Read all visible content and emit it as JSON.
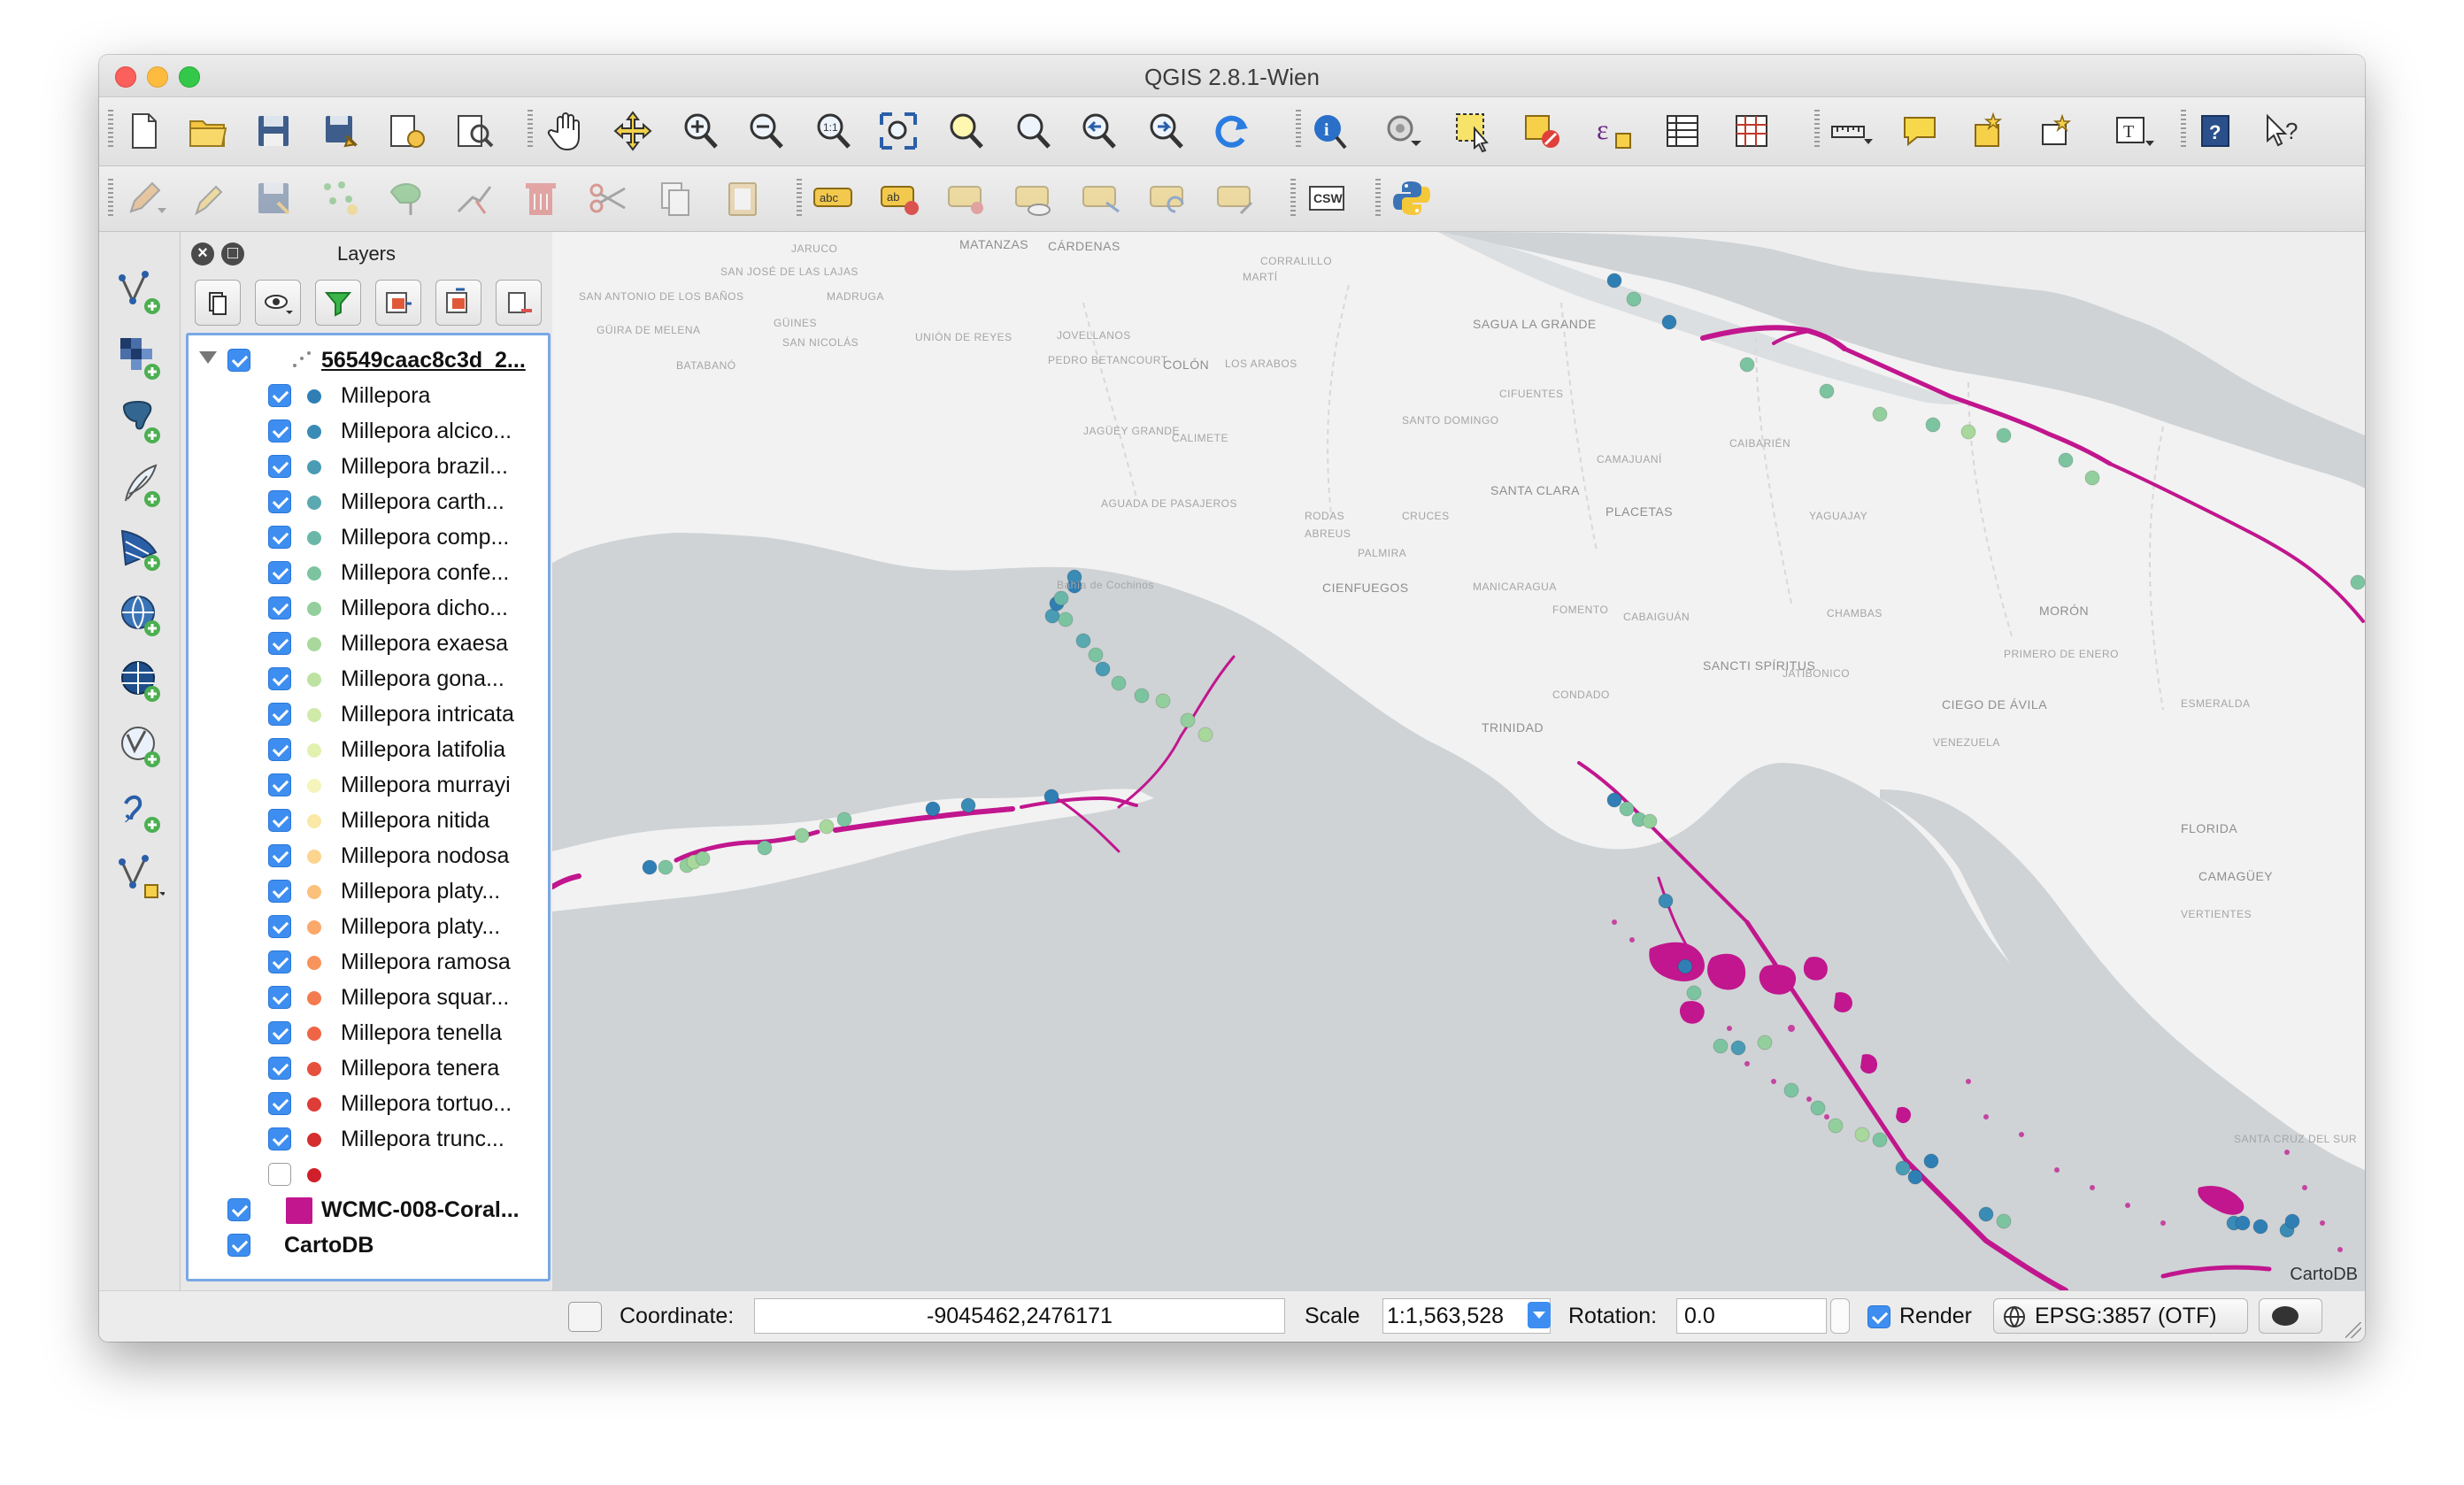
{
  "window": {
    "title": "QGIS 2.8.1-Wien"
  },
  "toolbar_main": {
    "icons": [
      "new-project-icon",
      "open-project-icon",
      "save-project-icon",
      "save-as-icon",
      "new-print-composer-icon",
      "composer-manager-icon",
      "pan-icon",
      "pan-to-selection-icon",
      "zoom-in-icon",
      "zoom-out-icon",
      "zoom-actual-icon",
      "zoom-full-icon",
      "zoom-to-selection-icon",
      "zoom-to-layer-icon",
      "zoom-last-icon",
      "zoom-next-icon",
      "refresh-icon",
      "identify-icon",
      "run-feature-action-icon",
      "select-features-icon",
      "deselect-icon",
      "field-calculator-icon",
      "attribute-table-icon",
      "statistics-icon",
      "measure-icon",
      "map-tips-icon",
      "bookmark-icon",
      "spatial-bookmarks-icon",
      "text-annotation-icon",
      "help-icon",
      "whats-this-icon"
    ]
  },
  "toolbar_edit": {
    "labels": {
      "csw": "CSW",
      "abc": "abc",
      "ab": "ab"
    }
  },
  "layers_panel": {
    "title": "Layers",
    "group": {
      "name": "56549caac8c3d_2...",
      "checked": true,
      "expanded": true
    },
    "items": [
      {
        "label": "Millepora",
        "color": "#2f7fb5",
        "checked": true
      },
      {
        "label": "Millepora alcico...",
        "color": "#3a8bb5",
        "checked": true
      },
      {
        "label": "Millepora brazil...",
        "color": "#4a9bb4",
        "checked": true
      },
      {
        "label": "Millepora carth...",
        "color": "#5aa8b0",
        "checked": true
      },
      {
        "label": "Millepora comp...",
        "color": "#6ab7a8",
        "checked": true
      },
      {
        "label": "Millepora confe...",
        "color": "#7cc4a0",
        "checked": true
      },
      {
        "label": "Millepora dicho...",
        "color": "#93cf9c",
        "checked": true
      },
      {
        "label": "Millepora exaesa",
        "color": "#a8d89c",
        "checked": true
      },
      {
        "label": "Millepora gona...",
        "color": "#bde2a2",
        "checked": true
      },
      {
        "label": "Millepora intricata",
        "color": "#d0eaa8",
        "checked": true
      },
      {
        "label": "Millepora latifolia",
        "color": "#e2f0b0",
        "checked": true
      },
      {
        "label": "Millepora murrayi",
        "color": "#f4f4bc",
        "checked": true
      },
      {
        "label": "Millepora nitida",
        "color": "#f9e8a6",
        "checked": true
      },
      {
        "label": "Millepora nodosa",
        "color": "#fbd48e",
        "checked": true
      },
      {
        "label": "Millepora platy...",
        "color": "#fbc07a",
        "checked": true
      },
      {
        "label": "Millepora platy...",
        "color": "#fba86a",
        "checked": true
      },
      {
        "label": "Millepora ramosa",
        "color": "#f8935c",
        "checked": true
      },
      {
        "label": "Millepora squar...",
        "color": "#f47b50",
        "checked": true
      },
      {
        "label": "Millepora tenella",
        "color": "#ee6546",
        "checked": true
      },
      {
        "label": "Millepora tenera",
        "color": "#e6513e",
        "checked": true
      },
      {
        "label": "Millepora tortuo...",
        "color": "#dd3d36",
        "checked": true
      },
      {
        "label": "Millepora trunc...",
        "color": "#d42e2e",
        "checked": true
      },
      {
        "label": "",
        "color": "#d01f2a",
        "checked": false
      }
    ],
    "extra_layers": [
      {
        "label": "WCMC-008-Coral...",
        "color": "#c1168e",
        "checked": true,
        "bold": true
      },
      {
        "label": "CartoDB",
        "checked": true,
        "bold": true
      }
    ]
  },
  "map": {
    "attribution": "CartoDB",
    "reef_color": "#c1168e",
    "land_color": "#f1f1f1",
    "sea_color": "#cfd3d6",
    "places": [
      "SAN JOSÉ DE LAS LAJAS",
      "MATANZAS",
      "CÁRDENAS",
      "JARUCO",
      "CORRALILLO",
      "SAN ANTONIO DE LOS BAÑOS",
      "MADRUGA",
      "GÜIRA DE MELENA",
      "GÜINES",
      "SAN NICOLÁS",
      "BATABANÓ",
      "UNIÓN DE REYES",
      "JOVELLANOS",
      "MARTÍ",
      "SAGUA LA GRANDE",
      "PEDRO BETANCOURT",
      "COLÓN",
      "LOS ARABOS",
      "CIFUENTES",
      "JAGÜEY GRANDE",
      "CALIMETE",
      "SANTO DOMINGO",
      "CAIBARIÉN",
      "CAMAJUANÍ",
      "SANTA CLARA",
      "PLACETAS",
      "YAGUAJAY",
      "AGUADA DE PASAJEROS",
      "RODAS",
      "CRUCES",
      "ABREUS",
      "PALMIRA",
      "CIENFUEGOS",
      "MANICARAGUA",
      "FOMENTO",
      "CABAIGUÁN",
      "CHAMBAS",
      "MORÓN",
      "PRIMERO DE ENERO",
      "SANCTI SPÍRITUS",
      "JATIBONICO",
      "CIEGO DE ÁVILA",
      "ESMERALDA",
      "CONDADO",
      "TRINIDAD",
      "VENEZUELA",
      "FLORIDA",
      "CAMAGÜEY",
      "VERTIENTES",
      "SANTA CRUZ DEL SUR",
      "Bahía de Cochinos"
    ]
  },
  "status_bar": {
    "coordinate_label": "Coordinate:",
    "coordinate_value": "-9045462,2476171",
    "scale_label": "Scale",
    "scale_value": "1:1,563,528",
    "rotation_label": "Rotation:",
    "rotation_value": "0.0",
    "render_label": "Render",
    "render_checked": true,
    "crs_label": "EPSG:3857 (OTF)"
  }
}
